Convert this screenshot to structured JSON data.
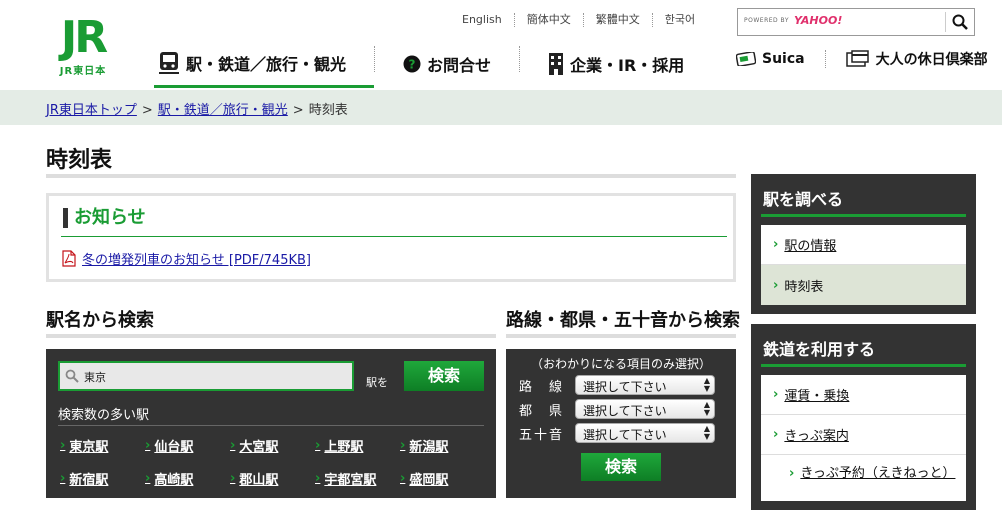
{
  "header": {
    "logo_text": "JR",
    "logo_sub": "JR東日本",
    "languages": [
      "English",
      "簡体中文",
      "繁體中文",
      "한국어"
    ],
    "search": {
      "powered_by": "POWERED BY",
      "provider": "YAHOO!",
      "placeholder": ""
    },
    "nav": [
      {
        "label": "駅・鉄道／旅行・観光",
        "icon": "train-icon",
        "active": true
      },
      {
        "label": "お問合せ",
        "icon": "question-icon",
        "active": false
      },
      {
        "label": "企業・IR・採用",
        "icon": "building-icon",
        "active": false
      }
    ],
    "subnav": [
      {
        "label": "Suica",
        "icon": "suica-card-icon"
      },
      {
        "label": "大人の休日倶楽部",
        "icon": "card-icon"
      }
    ]
  },
  "breadcrumb": {
    "items": [
      "JR東日本トップ",
      "駅・鉄道／旅行・観光"
    ],
    "current": "時刻表",
    "separator": ">"
  },
  "page": {
    "title": "時刻表"
  },
  "notice": {
    "heading": "お知らせ",
    "link": "冬の増発列車のお知らせ [PDF/745KB]"
  },
  "station_search": {
    "heading": "駅名から検索",
    "input_value": "東京",
    "suffix": "駅を",
    "button": "検索",
    "popular_label": "検索数の多い駅",
    "stations": [
      "東京駅",
      "仙台駅",
      "大宮駅",
      "上野駅",
      "新潟駅",
      "新宿駅",
      "高崎駅",
      "郡山駅",
      "宇都宮駅",
      "盛岡駅"
    ]
  },
  "route_search": {
    "heading": "路線・都県・五十音から検索",
    "hint": "（おわかりになる項目のみ選択）",
    "rows": [
      {
        "label": "路　線",
        "selected": "選択して下さい"
      },
      {
        "label": "都　県",
        "selected": "選択して下さい"
      },
      {
        "label": "五十音",
        "selected": "選択して下さい"
      }
    ],
    "button": "検索"
  },
  "sidebar": {
    "station_box": {
      "heading": "駅を調べる",
      "items": [
        "駅の情報",
        "時刻表"
      ]
    },
    "rail_box": {
      "heading": "鉄道を利用する",
      "items": [
        "運賃・乗換",
        "きっぷ案内"
      ],
      "sub_item": "きっぷ予約（えきねっと）"
    }
  },
  "colors": {
    "brand_green": "#1a9c34",
    "panel_dark": "#333333",
    "breadcrumb_bg": "#e4ece6",
    "link_blue": "#1a1aa6"
  }
}
